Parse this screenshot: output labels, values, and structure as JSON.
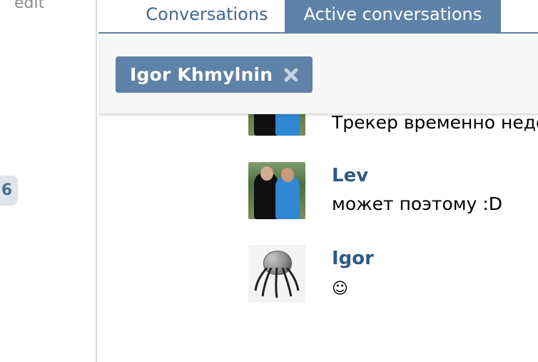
{
  "sidebar": {
    "edit_label": "edit",
    "counter": "6"
  },
  "tabs": {
    "conversations": "Conversations",
    "active_conversations": "Active conversations"
  },
  "filter": {
    "chip_label": "Igor Khmylnin",
    "close_icon": "close-icon"
  },
  "messages": [
    {
      "author": "",
      "text": "Трекер временно недо"
    },
    {
      "author": "Lev",
      "text": "может поэтому :D"
    },
    {
      "author": "Igor",
      "text": "☺"
    }
  ],
  "colors": {
    "accent": "#5e82a8",
    "author": "#2e5b85",
    "panel_bg": "#f7f7f7"
  }
}
